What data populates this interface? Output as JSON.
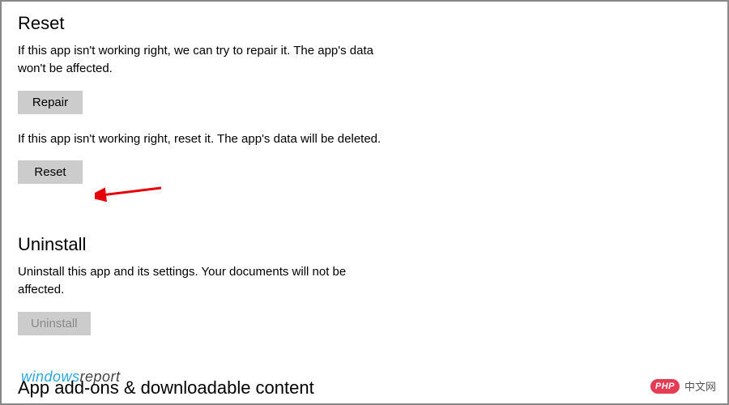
{
  "reset_section": {
    "heading": "Reset",
    "repair_desc": "If this app isn't working right, we can try to repair it. The app's data won't be affected.",
    "repair_label": "Repair",
    "reset_desc": "If this app isn't working right, reset it. The app's data will be deleted.",
    "reset_label": "Reset"
  },
  "uninstall_section": {
    "heading": "Uninstall",
    "desc": "Uninstall this app and its settings. Your documents will not be affected.",
    "uninstall_label": "Uninstall"
  },
  "addons_section": {
    "heading": "App add-ons & downloadable content"
  },
  "watermarks": {
    "left_part1": "windows",
    "left_part2": "report",
    "right_pill": "PHP",
    "right_text": "中文网"
  },
  "annotation": {
    "arrow_target": "reset-button"
  }
}
